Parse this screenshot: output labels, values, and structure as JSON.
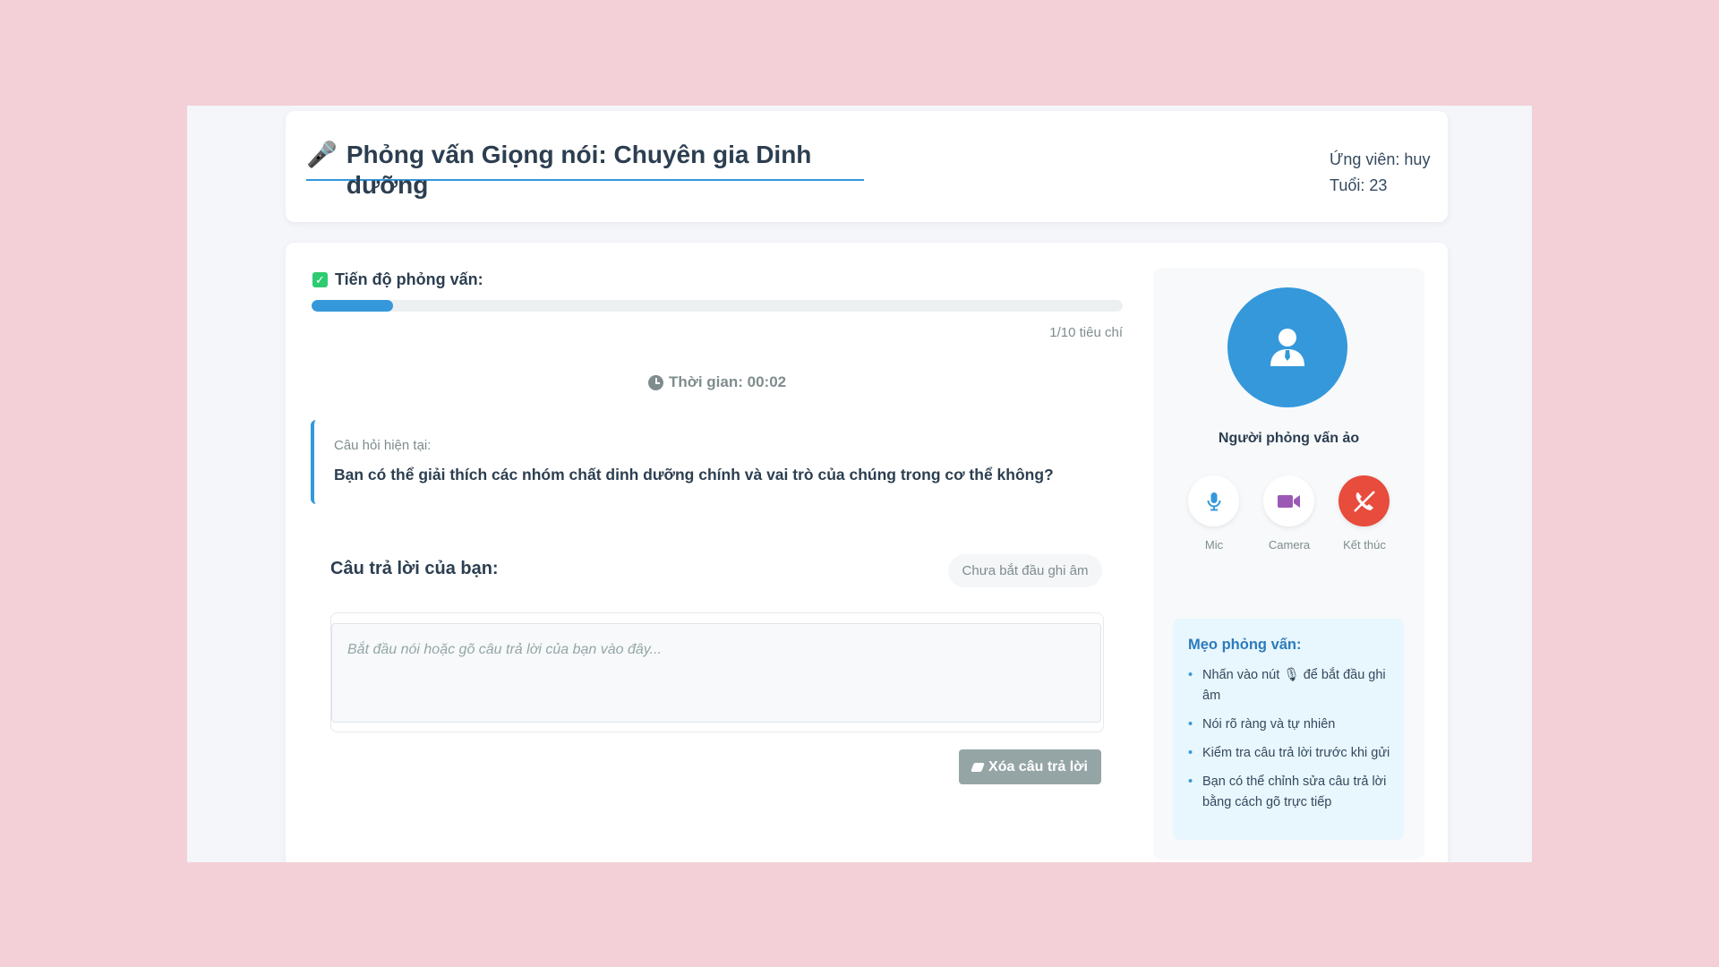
{
  "header": {
    "title_icon": "microphone-icon",
    "title": "Phỏng vấn Giọng nói: Chuyên gia Dinh dưỡng",
    "candidate": "Ứng viên: huy",
    "age": "Tuổi: 23"
  },
  "progress": {
    "label": "Tiến độ phỏng vấn:",
    "current": 1,
    "total": 10,
    "fraction": 0.1,
    "count_text": "1/10 tiêu chí"
  },
  "timer": {
    "text": "Thời gian: 00:02"
  },
  "question": {
    "label": "Câu hỏi hiện tại:",
    "text": "Bạn có thể giải thích các nhóm chất dinh dưỡng chính và vai trò của chúng trong cơ thể không?"
  },
  "answer": {
    "title": "Câu trả lời của bạn:",
    "status": "Chưa bắt đầu ghi âm",
    "value": "",
    "placeholder": "Bắt đầu nói hoặc gõ câu trả lời của bạn vào đây...",
    "clear_label": "Xóa câu trả lời"
  },
  "interviewer": {
    "name": "Người phỏng vấn ảo",
    "controls": {
      "mic": "Mic",
      "camera": "Camera",
      "end": "Kết thúc"
    }
  },
  "tips": {
    "title": "Mẹo phỏng vấn:",
    "items": [
      "Nhấn vào nút 🎙 để bắt đầu ghi âm",
      "Nói rõ ràng và tự nhiên",
      "Kiểm tra câu trả lời trước khi gửi",
      "Bạn có thể chỉnh sửa câu trả lời bằng cách gõ trực tiếp"
    ]
  },
  "colors": {
    "accent": "#3498db",
    "success": "#2ecc71",
    "danger": "#e74c3c",
    "camera": "#9b59b6",
    "muted_button": "#95a5a6",
    "page_background": "#f3d0d7"
  }
}
